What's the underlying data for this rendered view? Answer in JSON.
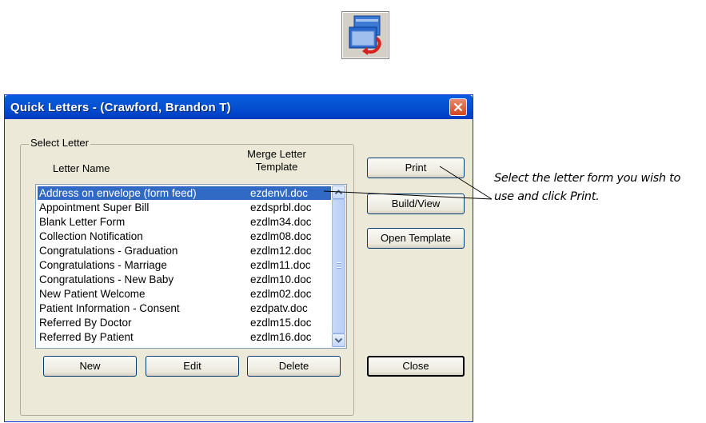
{
  "dialog": {
    "title": "Quick Letters - (Crawford, Brandon T)",
    "group_label": "Select Letter",
    "columns": {
      "name": "Letter Name",
      "merge_line1": "Merge Letter",
      "merge_line2": "Template"
    },
    "letters": [
      {
        "name": "Address on envelope (form feed)",
        "template": "ezdenvl.doc",
        "selected": true
      },
      {
        "name": "Appointment Super Bill",
        "template": "ezdsprbl.doc"
      },
      {
        "name": "Blank Letter Form",
        "template": "ezdlm34.doc"
      },
      {
        "name": "Collection Notification",
        "template": "ezdlm08.doc"
      },
      {
        "name": "Congratulations - Graduation",
        "template": "ezdlm12.doc"
      },
      {
        "name": "Congratulations - Marriage",
        "template": "ezdlm11.doc"
      },
      {
        "name": "Congratulations - New Baby",
        "template": "ezdlm10.doc"
      },
      {
        "name": "New Patient Welcome",
        "template": "ezdlm02.doc"
      },
      {
        "name": "Patient Information - Consent",
        "template": "ezdpatv.doc"
      },
      {
        "name": "Referred By Doctor",
        "template": "ezdlm15.doc"
      },
      {
        "name": "Referred By Patient",
        "template": "ezdlm16.doc"
      }
    ],
    "buttons": {
      "print": "Print",
      "build_view": "Build/View",
      "open_template": "Open Template",
      "new": "New",
      "edit": "Edit",
      "delete": "Delete",
      "close": "Close"
    }
  },
  "annotation": {
    "line1": "Select the letter form you wish to",
    "line2": "use and click Print."
  },
  "icons": {
    "toolbar": "quick-letters-icon",
    "close": "close-icon",
    "scroll_up": "chevron-up-icon",
    "scroll_down": "chevron-down-icon"
  },
  "colors": {
    "titlebar": "#0054e3",
    "selection": "#316ac5",
    "close_button": "#d3461c",
    "dialog_bg": "#ece9d8"
  }
}
